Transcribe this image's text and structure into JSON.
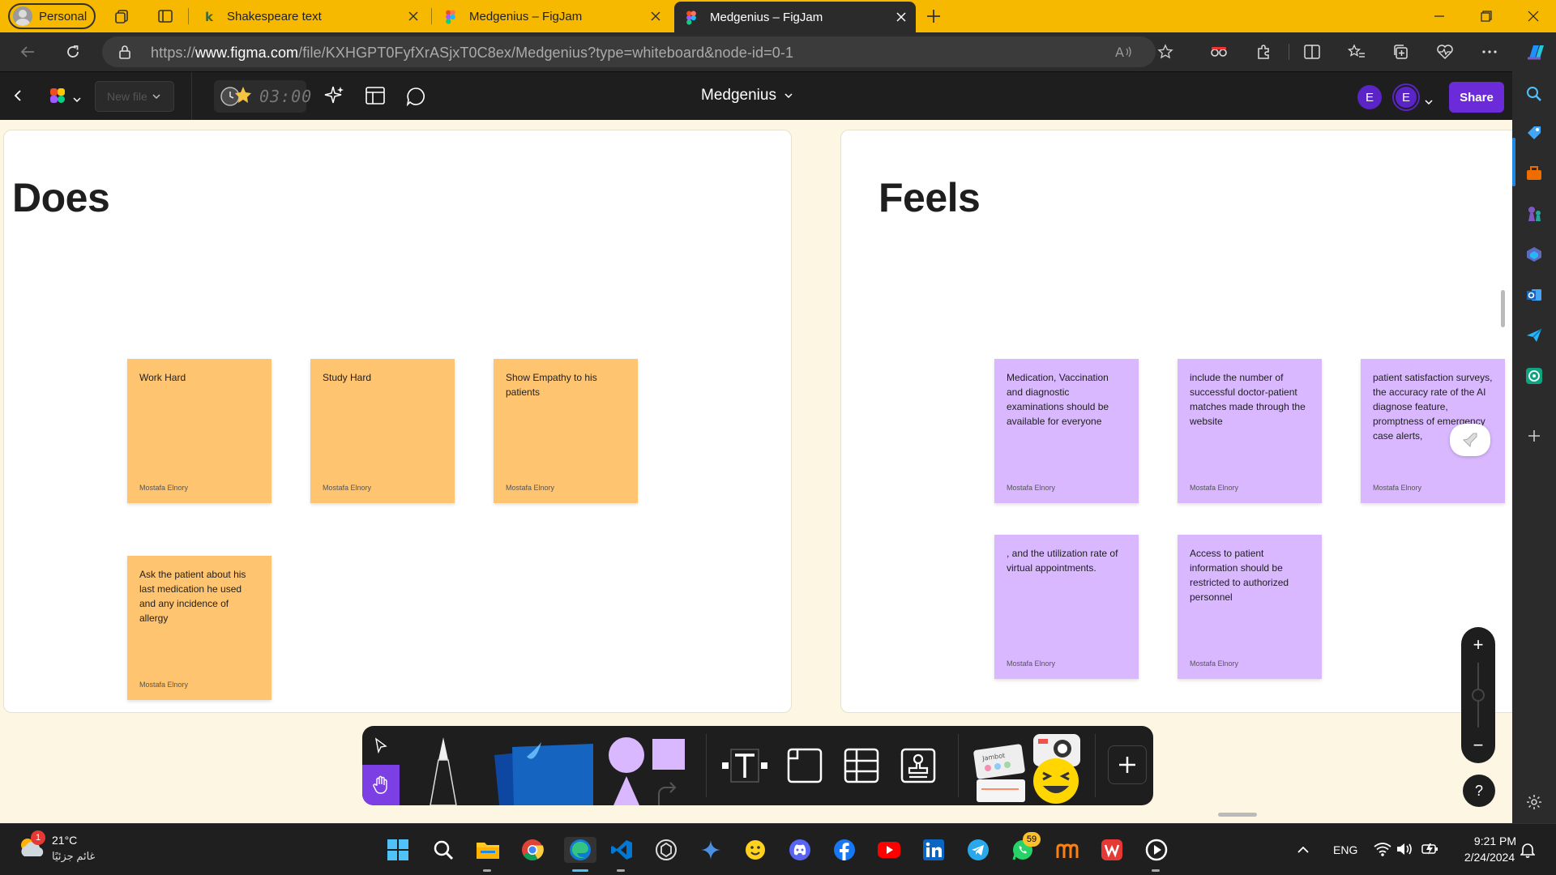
{
  "browser": {
    "profile_label": "Personal",
    "tabs": [
      {
        "title": "Shakespeare text"
      },
      {
        "title": "Medgenius – FigJam"
      },
      {
        "title": "Medgenius – FigJam"
      }
    ],
    "url_prefix": "https://",
    "url_domain": "www.figma.com",
    "url_path": "/file/KXHGPT0FyfXrASjxT0C8ex/Medgenius?type=whiteboard&node-id=0-1"
  },
  "figma": {
    "new_file_label": "New file",
    "timer": "03:00",
    "doc_name": "Medgenius",
    "avatars": [
      "E",
      "E"
    ],
    "share_label": "Share"
  },
  "canvas": {
    "sections": [
      {
        "title": "Does",
        "stickies": [
          {
            "text": "Work Hard",
            "author": "Mostafa Elnory"
          },
          {
            "text": "Study Hard",
            "author": "Mostafa Elnory"
          },
          {
            "text": "Show Empathy to his patients",
            "author": "Mostafa Elnory"
          },
          {
            "text": "Ask the patient about his last medication he used and any incidence of allergy",
            "author": "Mostafa Elnory"
          }
        ]
      },
      {
        "title": "Feels",
        "stickies": [
          {
            "text": "Medication, Vaccination and diagnostic examinations should be available for everyone",
            "author": "Mostafa Elnory"
          },
          {
            "text": "include the number of successful doctor-patient matches made through the website",
            "author": "Mostafa Elnory"
          },
          {
            "text": " patient satisfaction surveys, the accuracy rate of the AI diagnose feature, promptness of emergency case alerts,",
            "author": "Mostafa Elnory"
          },
          {
            "text": ", and the utilization rate of virtual appointments.",
            "author": "Mostafa Elnory"
          },
          {
            "text": "Access to patient information should be restricted to authorized personnel",
            "author": "Mostafa Elnory"
          }
        ]
      }
    ],
    "colors": {
      "orange_sticky": "#ffc470",
      "purple_sticky": "#d9b8ff",
      "canvas_bg": "#fdf6e3",
      "accent": "#6c2bd9"
    },
    "toolbar": {
      "sticker_text": "Jambot"
    }
  },
  "taskbar": {
    "weather_temp": "21°C",
    "weather_cond": "غائم جزئيًا",
    "weather_badge": "1",
    "whatsapp_badge": "59",
    "lang": "ENG",
    "time": "9:21 PM",
    "date": "2/24/2024"
  }
}
